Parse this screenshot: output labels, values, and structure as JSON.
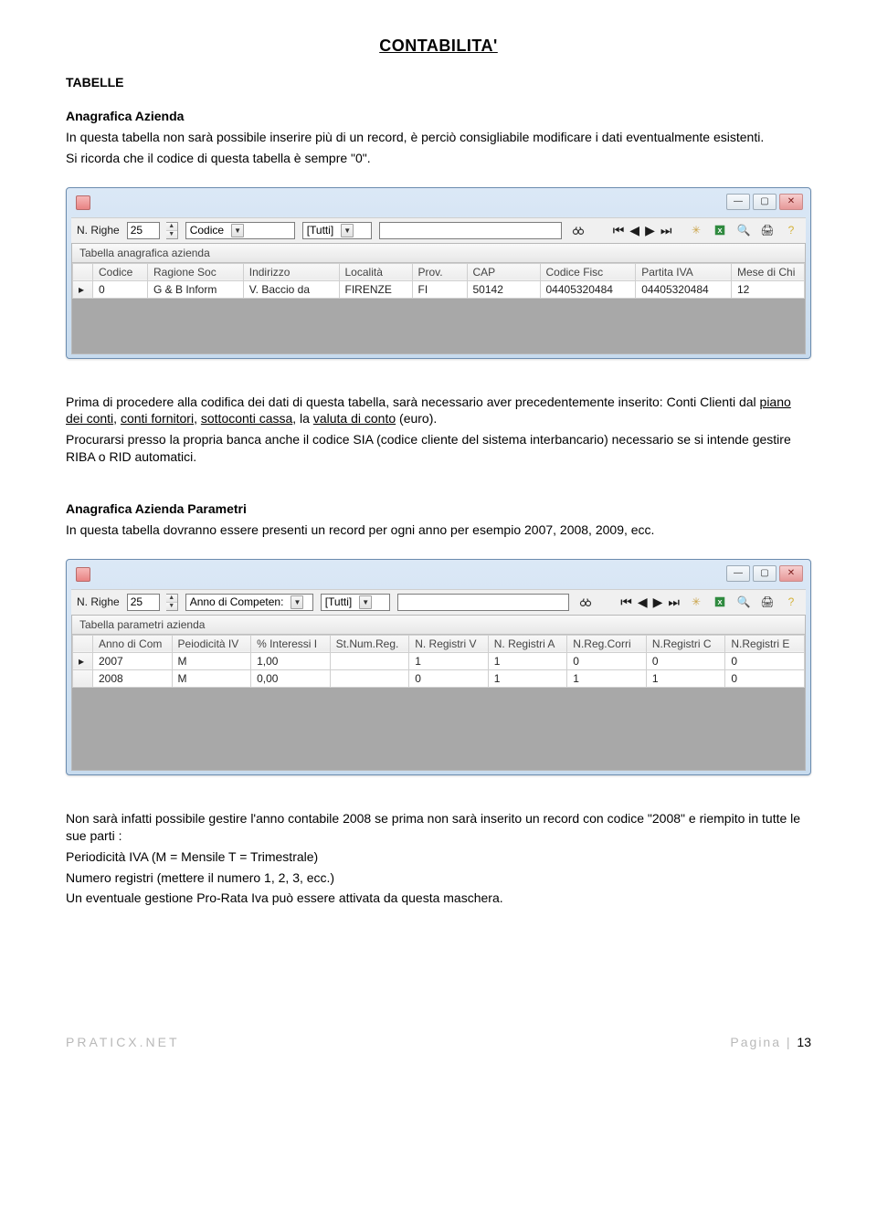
{
  "title": "CONTABILITA'",
  "section1": {
    "label": "TABELLE",
    "heading": "Anagrafica Azienda",
    "p1a": "In questa tabella non sarà possibile inserire più di un record, è perciò consigliabile modificare i dati eventualmente esistenti.",
    "p1b": "Si ricorda che il codice di questa tabella è sempre \"0\"."
  },
  "window1": {
    "nrighe_label": "N. Righe",
    "nrighe_value": "25",
    "combo1": "Codice",
    "combo2": "[Tutti]",
    "grid_title": "Tabella anagrafica azienda",
    "columns": [
      "Codice",
      "Ragione Soc",
      "Indirizzo",
      "Località",
      "Prov.",
      "CAP",
      "Codice Fisc",
      "Partita IVA",
      "Mese di Chi"
    ],
    "row": [
      "0",
      "G & B Inform",
      "V. Baccio da",
      "FIRENZE",
      "FI",
      "50142",
      "04405320484",
      "04405320484",
      "12"
    ]
  },
  "section2": {
    "p_pre": "Prima di procedere alla codifica dei dati di questa tabella, sarà necessario aver precedentemente inserito: Conti Clienti dal ",
    "u1": "piano dei conti",
    "sep1": ", ",
    "u2": "conti fornitori",
    "sep2": ", ",
    "u3": "sottoconti cassa",
    "sep3": ", la ",
    "u4": "valuta di conto",
    "tail": " (euro).",
    "p2": "Procurarsi presso la propria banca anche il codice SIA (codice cliente del sistema interbancario) necessario se si intende gestire RIBA o RID automatici."
  },
  "section3": {
    "heading": "Anagrafica Azienda Parametri",
    "p": "In questa tabella dovranno essere presenti un record per ogni anno per esempio 2007, 2008, 2009, ecc."
  },
  "window2": {
    "nrighe_label": "N. Righe",
    "nrighe_value": "25",
    "combo1": "Anno di Competen:",
    "combo2": "[Tutti]",
    "grid_title": "Tabella parametri azienda",
    "columns": [
      "Anno di Com",
      "Peiodicità IV",
      "% Interessi I",
      "St.Num.Reg.",
      "N. Registri V",
      "N. Registri A",
      "N.Reg.Corri",
      "N.Registri C",
      "N.Registri E"
    ],
    "rows": [
      [
        "2007",
        "M",
        "1,00",
        "",
        "1",
        "1",
        "0",
        "0",
        "0"
      ],
      [
        "2008",
        "M",
        "0,00",
        "",
        "0",
        "1",
        "1",
        "1",
        "0"
      ]
    ]
  },
  "section4": {
    "p1": "Non sarà infatti possibile gestire l'anno contabile 2008 se prima non sarà inserito un record con codice \"2008\" e riempito in tutte le sue parti :",
    "p2": "Periodicità IVA (M = Mensile T = Trimestrale)",
    "p3": "Numero registri (mettere il numero 1, 2, 3, ecc.)",
    "p4": "Un eventuale gestione Pro-Rata Iva può essere attivata da questa maschera."
  },
  "footer": {
    "left": "PRATICX.NET",
    "right_label": "Pagina | ",
    "right_num": "13"
  }
}
